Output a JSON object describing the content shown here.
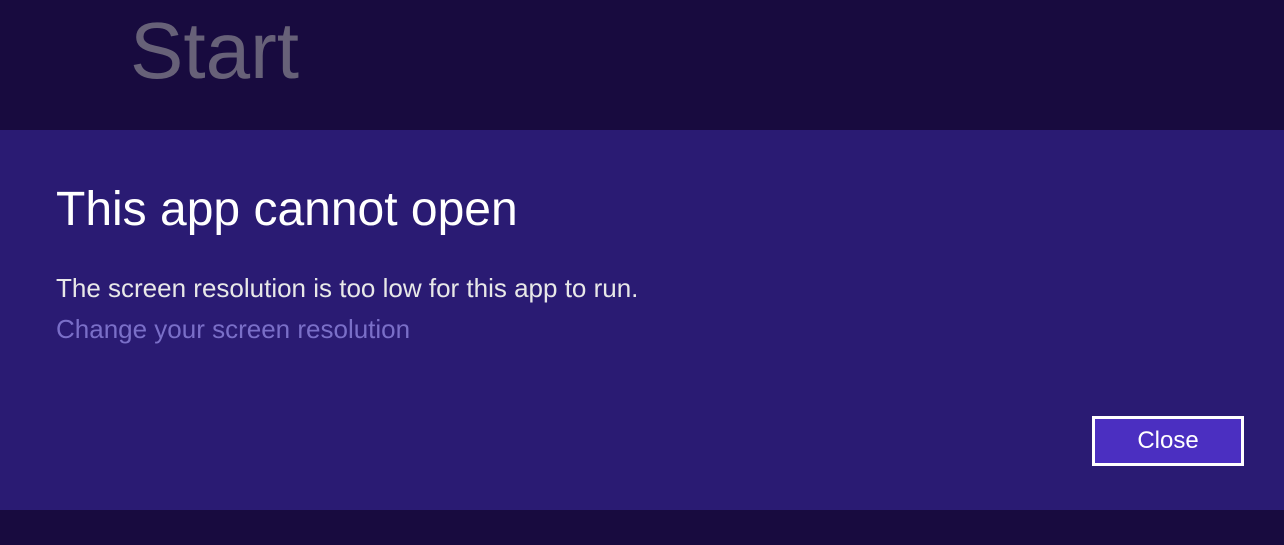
{
  "header": {
    "title": "Start"
  },
  "dialog": {
    "title": "This app cannot open",
    "message": "The screen resolution is too low for this app to run.",
    "link_text": "Change your screen resolution",
    "close_button_label": "Close"
  }
}
